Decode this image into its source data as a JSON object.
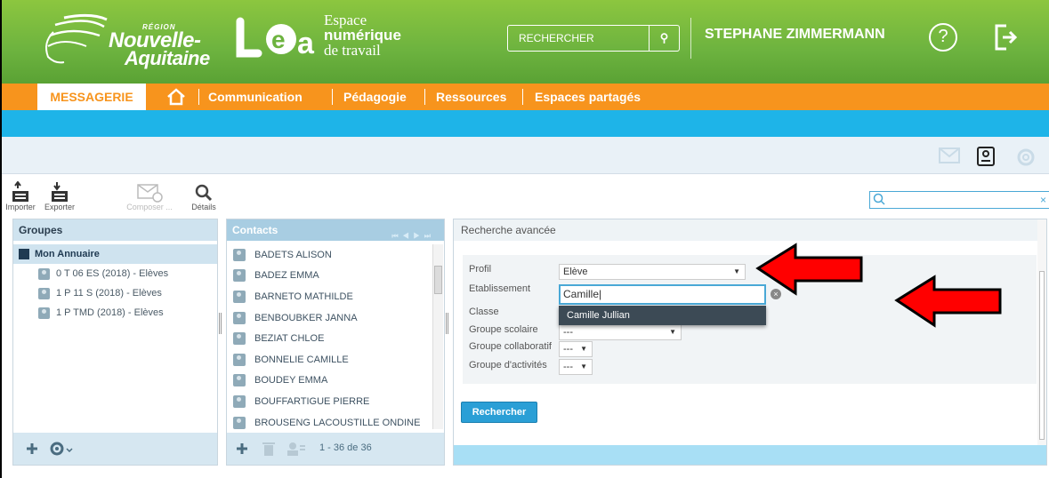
{
  "header": {
    "region_small": "RÉGION",
    "region_line1": "Nouvelle-",
    "region_line2": "Aquitaine",
    "espace_l1": "Espace",
    "espace_l2": "numérique",
    "espace_l3": "de travail",
    "search_placeholder": "RECHERCHER",
    "user_name": "STEPHANE ZIMMERMANN"
  },
  "nav": {
    "active": "MESSAGERIE",
    "items": [
      "Communication",
      "Pédagogie",
      "Ressources",
      "Espaces partagés"
    ]
  },
  "toolbar": {
    "importer": "Importer",
    "exporter": "Exporter",
    "composer": "Composer ...",
    "details": "Détails"
  },
  "groups": {
    "header": "Groupes",
    "root": "Mon Annuaire",
    "items": [
      "0 T 06 ES (2018) - Elèves",
      "1 P 11 S (2018) - Elèves",
      "1 P TMD (2018) - Elèves"
    ]
  },
  "contacts": {
    "header": "Contacts",
    "items": [
      "BADETS ALISON",
      "BADEZ EMMA",
      "BARNETO MATHILDE",
      "BENBOUBKER JANNA",
      "BEZIAT CHLOE",
      "BONNELIE CAMILLE",
      "BOUDEY EMMA",
      "BOUFFARTIGUE PIERRE",
      "BROUSENG LACOUSTILLE ONDINE"
    ],
    "count": "1 - 36 de 36"
  },
  "search": {
    "header": "Recherche avancée",
    "profil_label": "Profil",
    "profil_value": "Elève",
    "etab_label": "Etablissement",
    "etab_value": "Camille",
    "suggestion": "Camille Jullian",
    "classe_label": "Classe",
    "groupe_scolaire_label": "Groupe scolaire",
    "groupe_scolaire_value": "---",
    "groupe_collab_label": "Groupe collaboratif",
    "groupe_collab_value": "---",
    "groupe_activites_label": "Groupe d'activités",
    "groupe_activites_value": "---",
    "button": "Rechercher"
  }
}
